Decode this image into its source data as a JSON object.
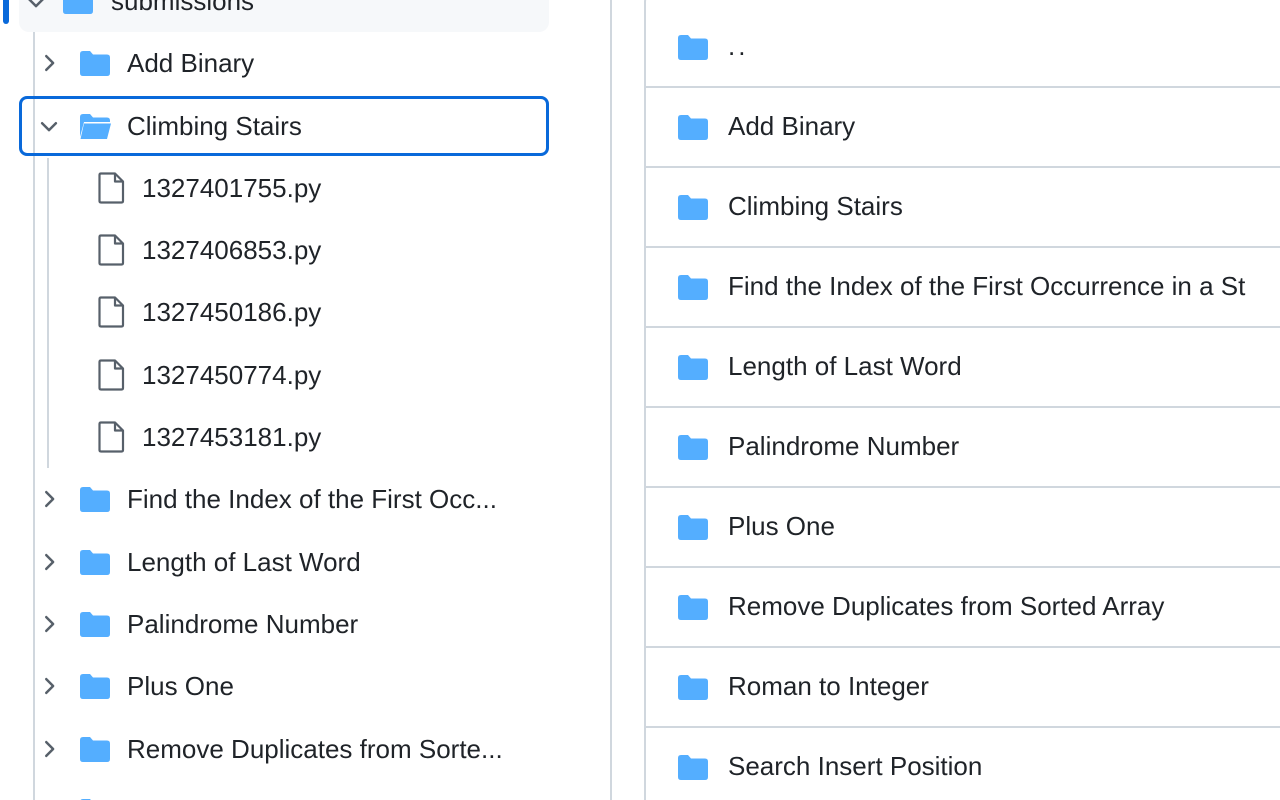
{
  "colors": {
    "folder": "#54aeff",
    "accent": "#0969da",
    "border": "#d0d7de",
    "text": "#1f2328",
    "icon_gray": "#57606a"
  },
  "sidebar": {
    "root": {
      "label": "submissions",
      "icon": "folder-open-icon",
      "expanded": true
    },
    "items": [
      {
        "label": "Add Binary",
        "icon": "folder-icon",
        "expanded": false
      },
      {
        "label": "Climbing Stairs",
        "icon": "folder-open-icon",
        "expanded": true,
        "selected": true,
        "children": [
          {
            "label": "1327401755.py",
            "icon": "file-icon"
          },
          {
            "label": "1327406853.py",
            "icon": "file-icon"
          },
          {
            "label": "1327450186.py",
            "icon": "file-icon"
          },
          {
            "label": "1327450774.py",
            "icon": "file-icon"
          },
          {
            "label": "1327453181.py",
            "icon": "file-icon"
          }
        ]
      },
      {
        "label": "Find the Index of the First Occ...",
        "icon": "folder-icon",
        "expanded": false
      },
      {
        "label": "Length of Last Word",
        "icon": "folder-icon",
        "expanded": false
      },
      {
        "label": "Palindrome Number",
        "icon": "folder-icon",
        "expanded": false
      },
      {
        "label": "Plus One",
        "icon": "folder-icon",
        "expanded": false
      },
      {
        "label": "Remove Duplicates from Sorte...",
        "icon": "folder-icon",
        "expanded": false
      }
    ]
  },
  "main": {
    "rows": [
      {
        "name": "..",
        "icon": "folder-icon"
      },
      {
        "name": "Add Binary",
        "icon": "folder-icon"
      },
      {
        "name": "Climbing Stairs",
        "icon": "folder-icon"
      },
      {
        "name": "Find the Index of the First Occurrence in a St",
        "icon": "folder-icon"
      },
      {
        "name": "Length of Last Word",
        "icon": "folder-icon"
      },
      {
        "name": "Palindrome Number",
        "icon": "folder-icon"
      },
      {
        "name": "Plus One",
        "icon": "folder-icon"
      },
      {
        "name": "Remove Duplicates from Sorted Array",
        "icon": "folder-icon"
      },
      {
        "name": "Roman to Integer",
        "icon": "folder-icon"
      },
      {
        "name": "Search Insert Position",
        "icon": "folder-icon"
      }
    ]
  }
}
